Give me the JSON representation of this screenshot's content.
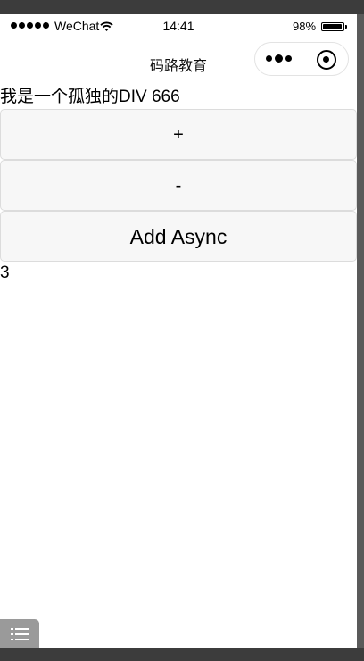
{
  "status_bar": {
    "carrier": "WeChat",
    "time": "14:41",
    "battery_percent": "98%",
    "battery_level": 0.98
  },
  "nav": {
    "title": "码路教育"
  },
  "content": {
    "intro_text": "我是一个孤独的DIV 666",
    "buttons": {
      "increment": "+",
      "decrement": "-",
      "add_async": "Add Async"
    },
    "counter": "3"
  }
}
